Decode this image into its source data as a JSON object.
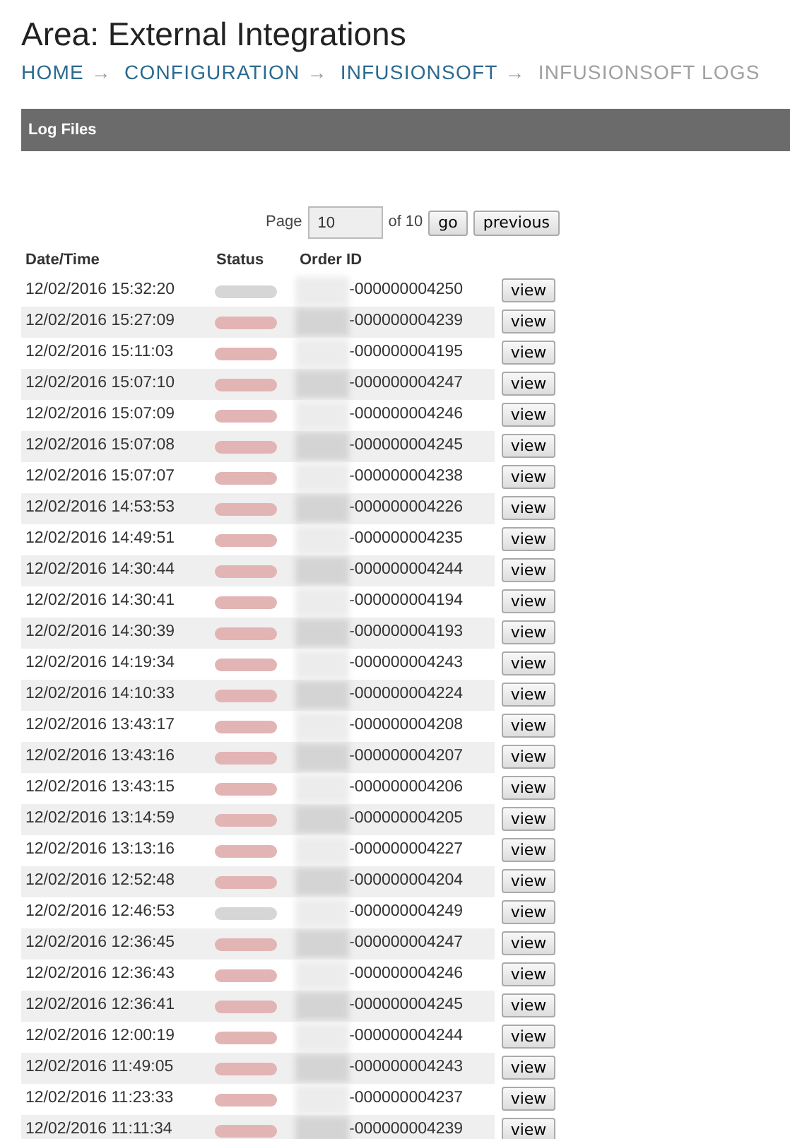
{
  "page_title": "Area: External Integrations",
  "breadcrumb": [
    {
      "label": "HOME",
      "current": false
    },
    {
      "label": "CONFIGURATION",
      "current": false
    },
    {
      "label": "INFUSIONSOFT",
      "current": false
    },
    {
      "label": "INFUSIONSOFT LOGS",
      "current": true
    }
  ],
  "breadcrumb_separator": "→",
  "panel": {
    "title": "Log Files"
  },
  "pagination": {
    "label": "Page",
    "value": "10",
    "total": "of 10",
    "buttons": [
      "go",
      "previous"
    ]
  },
  "table": {
    "columns": [
      "Date/Time",
      "Status",
      "Order ID"
    ],
    "rows": [
      {
        "date": "12/02/2016 15:32:20",
        "color": "#d6d6d6",
        "order_id": "-000000004250",
        "action": "view"
      },
      {
        "date": "12/02/2016 15:27:09",
        "color": "#e3b4b4",
        "order_id": "-000000004239",
        "action": "view"
      },
      {
        "date": "12/02/2016 15:11:03",
        "color": "#e3b4b4",
        "order_id": "-000000004195",
        "action": "view"
      },
      {
        "date": "12/02/2016 15:07:10",
        "color": "#e3b4b4",
        "order_id": "-000000004247",
        "action": "view"
      },
      {
        "date": "12/02/2016 15:07:09",
        "color": "#e3b4b4",
        "order_id": "-000000004246",
        "action": "view"
      },
      {
        "date": "12/02/2016 15:07:08",
        "color": "#e3b4b4",
        "order_id": "-000000004245",
        "action": "view"
      },
      {
        "date": "12/02/2016 15:07:07",
        "color": "#e3b4b4",
        "order_id": "-000000004238",
        "action": "view"
      },
      {
        "date": "12/02/2016 14:53:53",
        "color": "#e3b4b4",
        "order_id": "-000000004226",
        "action": "view"
      },
      {
        "date": "12/02/2016 14:49:51",
        "color": "#e3b4b4",
        "order_id": "-000000004235",
        "action": "view"
      },
      {
        "date": "12/02/2016 14:30:44",
        "color": "#e3b4b4",
        "order_id": "-000000004244",
        "action": "view"
      },
      {
        "date": "12/02/2016 14:30:41",
        "color": "#e3b4b4",
        "order_id": "-000000004194",
        "action": "view"
      },
      {
        "date": "12/02/2016 14:30:39",
        "color": "#e3b4b4",
        "order_id": "-000000004193",
        "action": "view"
      },
      {
        "date": "12/02/2016 14:19:34",
        "color": "#e3b4b4",
        "order_id": "-000000004243",
        "action": "view"
      },
      {
        "date": "12/02/2016 14:10:33",
        "color": "#e3b4b4",
        "order_id": "-000000004224",
        "action": "view"
      },
      {
        "date": "12/02/2016 13:43:17",
        "color": "#e3b4b4",
        "order_id": "-000000004208",
        "action": "view"
      },
      {
        "date": "12/02/2016 13:43:16",
        "color": "#e3b4b4",
        "order_id": "-000000004207",
        "action": "view"
      },
      {
        "date": "12/02/2016 13:43:15",
        "color": "#e3b4b4",
        "order_id": "-000000004206",
        "action": "view"
      },
      {
        "date": "12/02/2016 13:14:59",
        "color": "#e3b4b4",
        "order_id": "-000000004205",
        "action": "view"
      },
      {
        "date": "12/02/2016 13:13:16",
        "color": "#e3b4b4",
        "order_id": "-000000004227",
        "action": "view"
      },
      {
        "date": "12/02/2016 12:52:48",
        "color": "#e3b4b4",
        "order_id": "-000000004204",
        "action": "view"
      },
      {
        "date": "12/02/2016 12:46:53",
        "color": "#d6d6d6",
        "order_id": "-000000004249",
        "action": "view"
      },
      {
        "date": "12/02/2016 12:36:45",
        "color": "#e3b4b4",
        "order_id": "-000000004247",
        "action": "view"
      },
      {
        "date": "12/02/2016 12:36:43",
        "color": "#e3b4b4",
        "order_id": "-000000004246",
        "action": "view"
      },
      {
        "date": "12/02/2016 12:36:41",
        "color": "#e3b4b4",
        "order_id": "-000000004245",
        "action": "view"
      },
      {
        "date": "12/02/2016 12:00:19",
        "color": "#e3b4b4",
        "order_id": "-000000004244",
        "action": "view"
      },
      {
        "date": "12/02/2016 11:49:05",
        "color": "#e3b4b4",
        "order_id": "-000000004243",
        "action": "view"
      },
      {
        "date": "12/02/2016 11:23:33",
        "color": "#e3b4b4",
        "order_id": "-000000004237",
        "action": "view"
      },
      {
        "date": "12/02/2016 11:11:34",
        "color": "#e3b4b4",
        "order_id": "-000000004239",
        "action": "view"
      }
    ]
  }
}
